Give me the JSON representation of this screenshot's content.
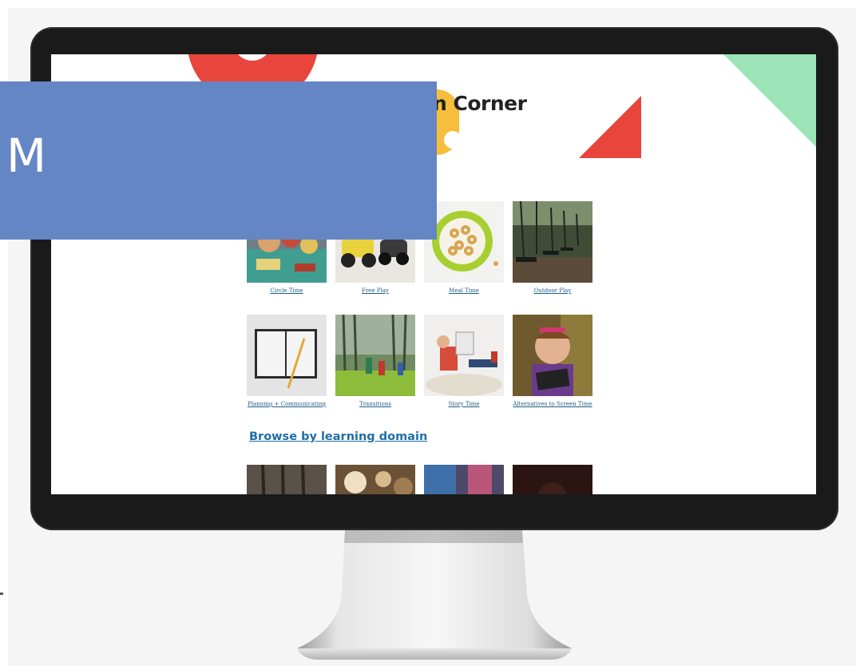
{
  "site": {
    "title_fragment": "n Corner"
  },
  "activities": [
    {
      "label": "Circle Time",
      "icon": "toys-on-table-photo"
    },
    {
      "label": "Free Play",
      "icon": "toy-cars-photo"
    },
    {
      "label": "Meal Time",
      "icon": "cereal-bowl-photo"
    },
    {
      "label": "Outdoor Play",
      "icon": "swings-photo"
    },
    {
      "label": "Planning + Communicating",
      "icon": "notebook-pencil-photo"
    },
    {
      "label": "Transitions",
      "icon": "children-playing-outdoors-photo"
    },
    {
      "label": "Story Time",
      "icon": "child-reading-photo"
    },
    {
      "label": "Alternatives to Screen Time",
      "icon": "child-with-tablet-photo"
    }
  ],
  "learning_domain": {
    "heading": "Browse by learning domain"
  },
  "banner": {
    "text": "M"
  },
  "colors": {
    "banner": "#6586c5",
    "accent_red": "#e8453c",
    "accent_yellow": "#f6be3a",
    "accent_green": "#9ce3b8",
    "link_blue": "#1f6ea6"
  }
}
